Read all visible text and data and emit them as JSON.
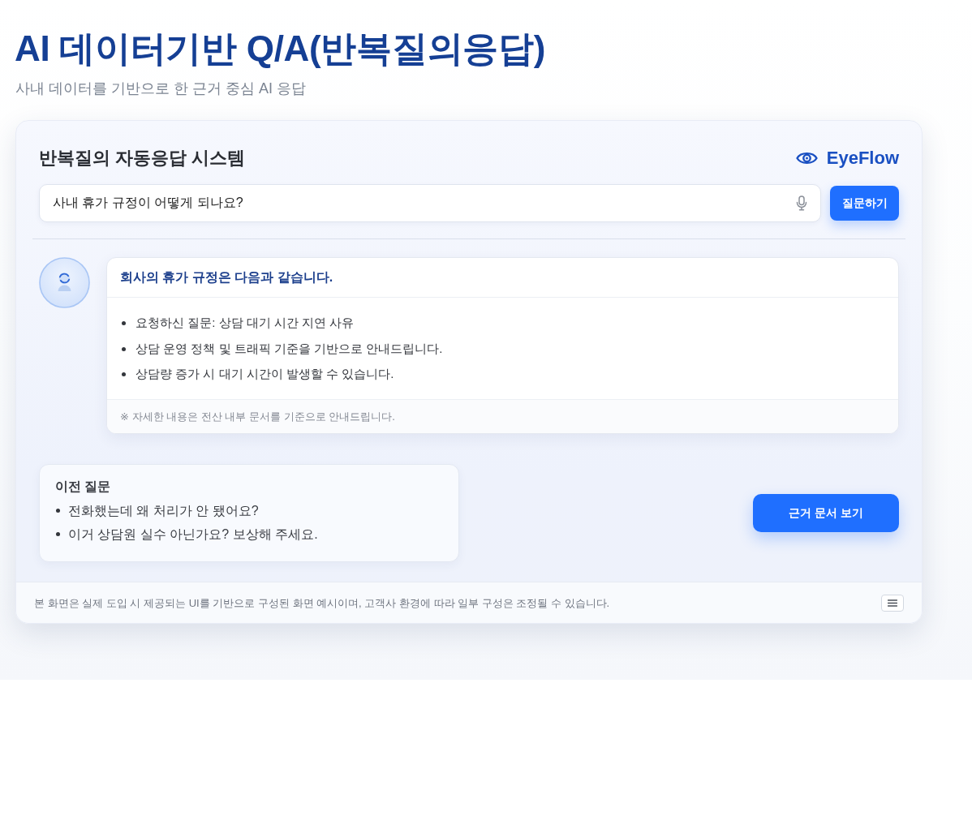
{
  "header": {
    "title": "AI 데이터기반 Q/A(반복질의응답)",
    "subtitle": "사내 데이터를 기반으로 한 근거 중심 AI 응답"
  },
  "panel": {
    "title": "반복질의 자동응답 시스템",
    "brand": "EyeFlow",
    "question": {
      "value": "사내 휴가 규정이 어떻게 되나요?"
    },
    "ask_button": "질문하기",
    "answer": {
      "heading": "회사의 휴가 규정은 다음과 같습니다.",
      "items": [
        "요청하신 질문: 상담 대기 시간 지연 사유",
        "상담 운영 정책 및 트래픽 기준을 기반으로 안내드립니다.",
        "상담량 증가 시 대기 시간이 발생할 수 있습니다."
      ],
      "note": "※ 자세한 내용은 전산 내부 문서를 기준으로 안내드립니다."
    },
    "previous_questions": {
      "title": "이전 질문",
      "items": [
        "전화했는데 왜 처리가 안 됐어요?",
        "이거 상담원 실수 아닌가요? 보상해 주세요."
      ]
    },
    "evidence_button": "근거 문서 보기",
    "footer": {
      "text": "본 화면은 실제 도입 시 제공되는 UI를 기반으로 구성된 화면 예시이며, 고객사 환경에 따라 일부 구성은 조정될 수 있습니다."
    }
  }
}
